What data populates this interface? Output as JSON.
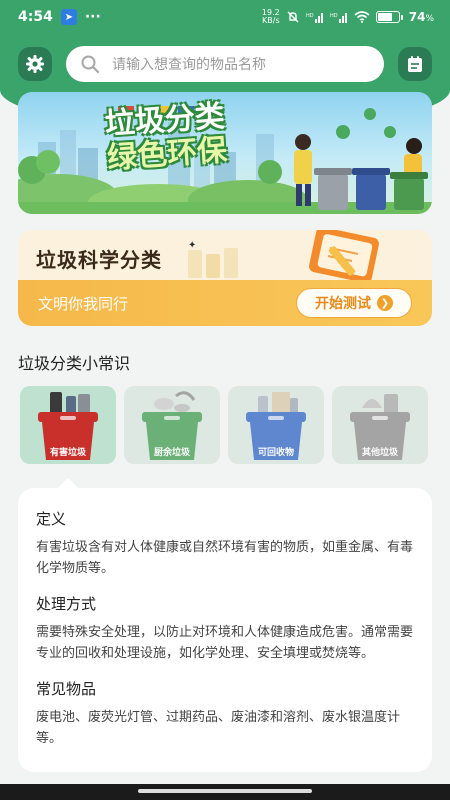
{
  "status_bar": {
    "time": "4:54",
    "net_speed_value": "19.2",
    "net_speed_unit": "KB/s",
    "battery_text": "74",
    "battery_percent_sign": "%",
    "battery_level": 0.74
  },
  "header": {
    "search_placeholder": "请输入想查询的物品名称"
  },
  "banner": {
    "title_line1": "垃圾分类",
    "title_line2": "绿色环保"
  },
  "science_card": {
    "title": "垃圾科学分类",
    "subtitle": "文明你我同行",
    "button_label": "开始测试"
  },
  "knowledge": {
    "section_title": "垃圾分类小常识",
    "categories": [
      {
        "label": "有害垃圾",
        "color": "#c9302c",
        "selected": true
      },
      {
        "label": "厨余垃圾",
        "color": "#3f9a4e",
        "selected": false
      },
      {
        "label": "可回收物",
        "color": "#2e63c4",
        "selected": false
      },
      {
        "label": "其他垃圾",
        "color": "#8a8a8a",
        "selected": false
      }
    ],
    "detail": {
      "definition_title": "定义",
      "definition_text": "有害垃圾含有对人体健康或自然环境有害的物质，如重金属、有毒化学物质等。",
      "handling_title": "处理方式",
      "handling_text": "需要特殊安全处理，以防止对环境和人体健康造成危害。通常需要专业的回收和处理设施，如化学处理、安全填埋或焚烧等。",
      "items_title": "常见物品",
      "items_text": "废电池、废荧光灯管、过期药品、废油漆和溶剂、废水银温度计等。"
    }
  },
  "colors": {
    "primary_green": "#3aa46a",
    "dark_green": "#2b7c55",
    "orange": "#f6b84a"
  }
}
